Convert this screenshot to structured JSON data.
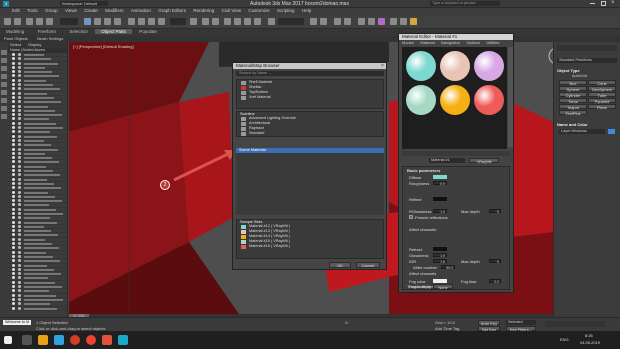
{
  "app": {
    "title": "Autodesk 3ds Max 2017   bocem2domao.max",
    "workspace": "Workspace: Default",
    "search_placeholder": "Type a keyword or phrase"
  },
  "menu": [
    "Edit",
    "Tools",
    "Group",
    "Views",
    "Create",
    "Modifiers",
    "Animation",
    "Graph Editors",
    "Rendering",
    "Civil View",
    "Customize",
    "Scripting",
    "Help"
  ],
  "ribbon": {
    "tabs": [
      "Modeling",
      "Freeform",
      "Selection",
      "Object Paint",
      "Populate"
    ],
    "active_tab": "Object Paint",
    "sub": [
      "Paint Objects",
      "Brush Settings"
    ]
  },
  "scene_explorer": {
    "tabs": [
      "Select",
      "Display"
    ],
    "header": "Name (Sorted Ascen"
  },
  "viewport": {
    "label": "[+] [Perspective] [Default Shading]",
    "annotation_number": "2"
  },
  "mat_browser": {
    "title": "Material/Map Browser",
    "search_placeholder": "Search by Name ...",
    "standard_items": [
      "Shell Material",
      "Shellac",
      "Top/Bottom",
      "Xref Material"
    ],
    "scanline_header": "Scanline",
    "scanline_items": [
      "Advanced Lighting Override",
      "Architectural",
      "Raytrace",
      "Standard"
    ],
    "scene_materials_header": "Scene Materials",
    "sample_slots_header": "Sample Slots",
    "sample_items": [
      "Material #12  ( VRayMtl )",
      "Material #13  ( VRayMtl )",
      "Material #14  ( VRayMtl )",
      "Material #15  ( VRayMtl )",
      "Material #16  ( VRayMtl )"
    ],
    "ok": "OK",
    "cancel": "Cancel"
  },
  "mat_editor": {
    "title": "Material Editor - Material #1",
    "menu": [
      "Modes",
      "Material",
      "Navigation",
      "Options",
      "Utilities"
    ],
    "slot_colors": [
      "#7dd8cf",
      "#e8c4b6",
      "#d7a8e4",
      "#a5d9c4",
      "#f4b014",
      "#ef5b58"
    ],
    "material_name": "Material #1",
    "material_type": "VRayMtl",
    "basic_parameters": "Basic parameters",
    "diffuse": "Diffuse",
    "roughness": "Roughness",
    "reflect": "Reflect",
    "gloss": "RGlossiness",
    "fresnel": "Fresnel reflections",
    "affect_channels": "Affect channels",
    "max_depth": "Max depth",
    "refract": "Refract",
    "glossiness": "Glossiness",
    "ior": "IOR",
    "abbe": "Abbe number",
    "fog_color": "Fog color",
    "fog_mult": "Fog multiplier",
    "fog_bias": "Fog bias",
    "translucency": "Translucency",
    "none": "None",
    "val_0": "0.0",
    "val_1": "1.0",
    "val_5": "5",
    "val_16": "1.6",
    "val_50": "50.0"
  },
  "command_panel": {
    "dropdown": "Standard Primitives",
    "object_type_header": "Object Type",
    "autogrid": "AutoGrid",
    "buttons": [
      "Box",
      "Cone",
      "Sphere",
      "GeoSphere",
      "Cylinder",
      "Tube",
      "Torus",
      "Pyramid",
      "Teapot",
      "Plane",
      "TextPlus"
    ],
    "name_color_header": "Name and Color",
    "object_name": "Layer:Windows"
  },
  "status": {
    "maxscript": "Welcome to M",
    "selected": "1 Object Selected",
    "hint": "Click or click-and-drag to select objects",
    "timeline": "0 / 100",
    "x_label": "X:",
    "grid": "Grid = 10,0",
    "add_time_tag": "Add Time Tag",
    "auto_key": "Auto Key",
    "selected_dd": "Selected",
    "set_key": "Set Key",
    "key_filters": "Key Filters...",
    "time": "8:26",
    "date": "04.05.2019",
    "lang": "ENG"
  },
  "accent_colors": {
    "viewport_red": "#c8151c",
    "arrow": "#d9534f",
    "selection_blue": "#3b6fb2"
  }
}
